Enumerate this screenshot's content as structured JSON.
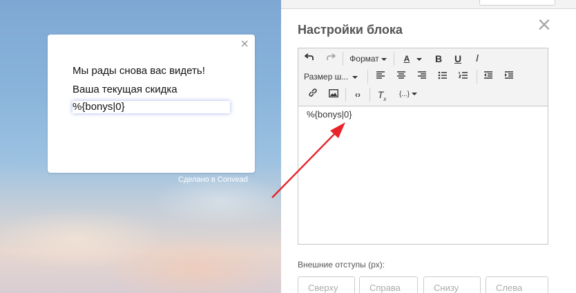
{
  "popup": {
    "line1": "Мы рады снова вас видеть!",
    "line2": "Ваша текущая скидка",
    "line3": "%{bonys|0}",
    "close_glyph": "×"
  },
  "footer": {
    "made_with": "Сделано в Convead"
  },
  "panel": {
    "title": "Настройки блока",
    "close_glyph": "×"
  },
  "toolbar": {
    "format_label": "Формат",
    "font_size_label": "Размер ш...",
    "undo_icon": "undo-icon",
    "redo_icon": "redo-icon"
  },
  "editor": {
    "content": "%{bonys|0}"
  },
  "margins": {
    "label": "Внешние отступы (px):",
    "top_placeholder": "Сверху",
    "right_placeholder": "Справа",
    "bottom_placeholder": "Снизу",
    "left_placeholder": "Слева"
  },
  "colors": {
    "arrow": "#e8232a",
    "panel_title": "#555555"
  }
}
